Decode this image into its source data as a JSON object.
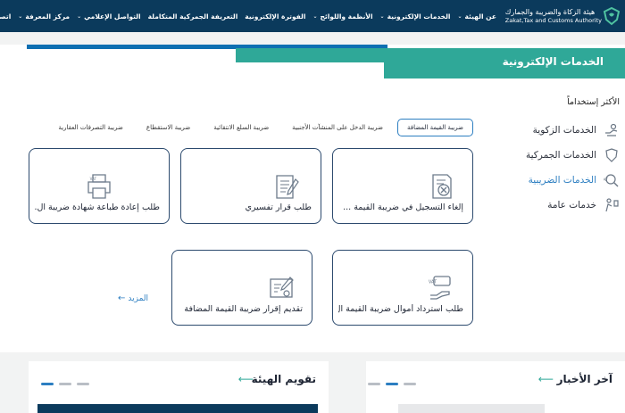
{
  "header": {
    "brand_ar": "هيئة الزكاة والضريبة والجمارك",
    "brand_en": "Zakat,Tax and Customs Authority",
    "nav": [
      {
        "label": "عن الهيئة",
        "dropdown": true
      },
      {
        "label": "الخدمات الإلكترونية",
        "dropdown": true
      },
      {
        "label": "الأنظمة واللوائح",
        "dropdown": true
      },
      {
        "label": "الفوترة الإلكترونية",
        "dropdown": false
      },
      {
        "label": "التعريفة الجمركية المتكاملة",
        "dropdown": false
      },
      {
        "label": "التواصل الإعلامي",
        "dropdown": true
      },
      {
        "label": "مركز المعرفة",
        "dropdown": true
      },
      {
        "label": "اتصل بنا",
        "dropdown": false
      }
    ]
  },
  "services": {
    "title": "الخدمات الإلكترونية",
    "most_used": "الأكثر إستخداماً",
    "categories": [
      {
        "label": "الخدمات الزكوية",
        "icon": "zakat-hand-icon"
      },
      {
        "label": "الخدمات الجمركية",
        "icon": "customs-shield-icon"
      },
      {
        "label": "الخدمات الضريبية",
        "icon": "tax-search-icon",
        "active": true
      },
      {
        "label": "خدمات عامة",
        "icon": "general-services-icon"
      }
    ],
    "tabs": [
      {
        "label": "ضريبة القيمة المضافة",
        "active": true
      },
      {
        "label": "ضريبة الدخل على المنشآت الأجنبية"
      },
      {
        "label": "ضريبة السلع الانتقائية"
      },
      {
        "label": "ضريبة الاستقطاع"
      },
      {
        "label": "ضريبة التصرفات العقارية"
      }
    ],
    "cards": [
      {
        "label": "إلغاء التسجيل في ضريبة القيمة ...",
        "icon": "cancel-document-icon"
      },
      {
        "label": "طلب قرار تفسيري",
        "icon": "document-pen-icon"
      },
      {
        "label": "طلب إعادة طباعة شهادة ضريبة ال...",
        "icon": "printer-icon"
      },
      {
        "label": "طلب استرداد أموال ضريبة القيمة ال...",
        "icon": "vat-refund-icon"
      },
      {
        "label": "تقديم إقرار ضريبة القيمة المضافة",
        "icon": "vat-return-icon"
      }
    ],
    "more": "المزيد"
  },
  "bottom": {
    "news_title": "آخر الأخبار",
    "calendar_title": "تقويم الهيئة"
  },
  "colors": {
    "nav_bg": "#0b3a5c",
    "teal": "#2fa898",
    "blue": "#2c7ec1"
  }
}
